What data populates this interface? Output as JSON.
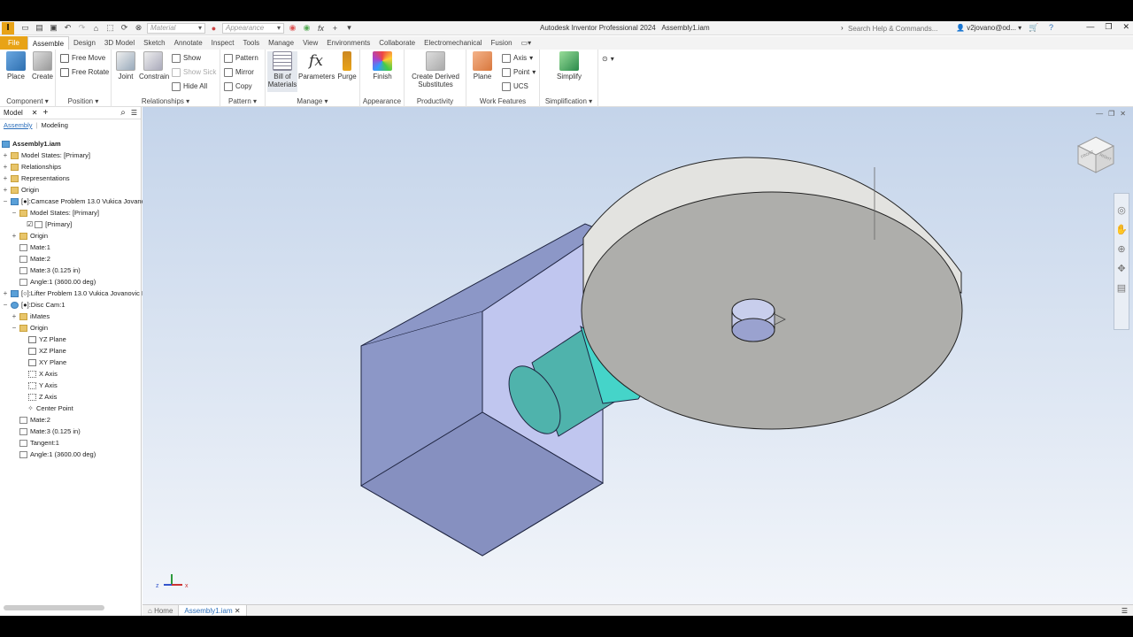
{
  "app": {
    "logo": "I",
    "title": "Autodesk Inventor Professional 2024",
    "document": "Assembly1.iam"
  },
  "qat": {
    "material": "Material",
    "appearance": "Appearance"
  },
  "search": {
    "placeholder": "Search Help & Commands..."
  },
  "user": {
    "name": "v2jovano@od..."
  },
  "tabs": [
    "File",
    "Assemble",
    "Design",
    "3D Model",
    "Sketch",
    "Annotate",
    "Inspect",
    "Tools",
    "Manage",
    "View",
    "Environments",
    "Collaborate",
    "Electromechanical",
    "Fusion"
  ],
  "ribbon": {
    "component": {
      "label": "Component ▾",
      "place": "Place",
      "create": "Create"
    },
    "position": {
      "label": "Position ▾",
      "free_move": "Free Move",
      "free_rotate": "Free Rotate"
    },
    "relationships": {
      "label": "Relationships ▾",
      "joint": "Joint",
      "constrain": "Constrain",
      "show": "Show",
      "show_sick": "Show Sick",
      "hide_all": "Hide All"
    },
    "pattern": {
      "label": "Pattern ▾",
      "pattern": "Pattern",
      "mirror": "Mirror",
      "copy": "Copy"
    },
    "manage": {
      "label": "Manage ▾",
      "bom1": "Bill of",
      "bom2": "Materials",
      "parameters": "Parameters",
      "purge": "Purge"
    },
    "appearance": {
      "label": "Appearance",
      "finish": "Finish"
    },
    "productivity": {
      "label": "Productivity",
      "cds1": "Create Derived",
      "cds2": "Substitutes"
    },
    "work_features": {
      "label": "Work Features",
      "plane": "Plane",
      "axis": "Axis",
      "point": "Point",
      "ucs": "UCS"
    },
    "simplification": {
      "label": "Simplification ▾",
      "simplify": "Simplify"
    }
  },
  "browser": {
    "tab": "Model",
    "subtab_assembly": "Assembly",
    "subtab_modeling": "Modeling",
    "rows": [
      {
        "text": "Assembly1.iam"
      },
      {
        "text": "Model States: [Primary]"
      },
      {
        "text": "Relationships"
      },
      {
        "text": "Representations"
      },
      {
        "text": "Origin"
      },
      {
        "text": "[●]:Camcase Problem 13.0 Vukica Jovanov"
      },
      {
        "text": "Model States: [Primary]"
      },
      {
        "text": "[Primary]"
      },
      {
        "text": "Origin"
      },
      {
        "text": "Mate:1"
      },
      {
        "text": "Mate:2"
      },
      {
        "text": "Mate:3 (0.125 in)"
      },
      {
        "text": "Angle:1 (3600.00 deg)"
      },
      {
        "text": "[○]:Lifter Problem 13.0 Vukica Jovanovic El"
      },
      {
        "text": "[●]:Disc Cam:1"
      },
      {
        "text": "iMates"
      },
      {
        "text": "Origin"
      },
      {
        "text": "YZ Plane"
      },
      {
        "text": "XZ Plane"
      },
      {
        "text": "XY Plane"
      },
      {
        "text": "X Axis"
      },
      {
        "text": "Y Axis"
      },
      {
        "text": "Z Axis"
      },
      {
        "text": "Center Point"
      },
      {
        "text": "Mate:2"
      },
      {
        "text": "Mate:3 (0.125 in)"
      },
      {
        "text": "Tangent:1"
      },
      {
        "text": "Angle:1 (3600.00 deg)"
      }
    ]
  },
  "viewcube": {
    "front": "FRONT",
    "right": "RIGHT"
  },
  "doctabs": {
    "home": "Home",
    "active": "Assembly1.iam"
  },
  "colors": {
    "accent": "#e8a317",
    "link": "#2a6ebb"
  }
}
